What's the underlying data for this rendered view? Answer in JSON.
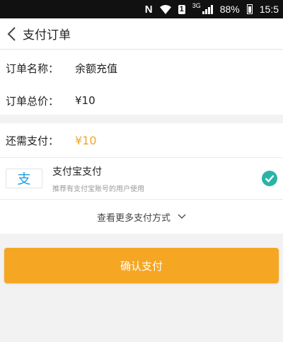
{
  "status_bar": {
    "carrier_icon": "N",
    "sim_badge": "1",
    "network": "3G",
    "battery_pct": "88%",
    "time": "15:5"
  },
  "header": {
    "back_icon": "chevron-left-icon",
    "title": "支付订单"
  },
  "order": {
    "name_label": "订单名称：",
    "name_value": "余额充值",
    "total_label": "订单总价：",
    "total_value": "¥10"
  },
  "payment_due": {
    "label": "还需支付：",
    "value": "¥10",
    "accent_color": "#f5a623"
  },
  "payment_method": {
    "icon": "alipay-logo-icon",
    "logo_char": "支",
    "name": "支付宝支付",
    "subtitle": "推荐有支付宝账号的用户使用",
    "selected": true,
    "check_color": "#2bb3a7"
  },
  "more_methods": {
    "label": "查看更多支付方式",
    "icon": "chevron-down-icon"
  },
  "confirm": {
    "label": "确认支付",
    "color": "#f5a623"
  }
}
